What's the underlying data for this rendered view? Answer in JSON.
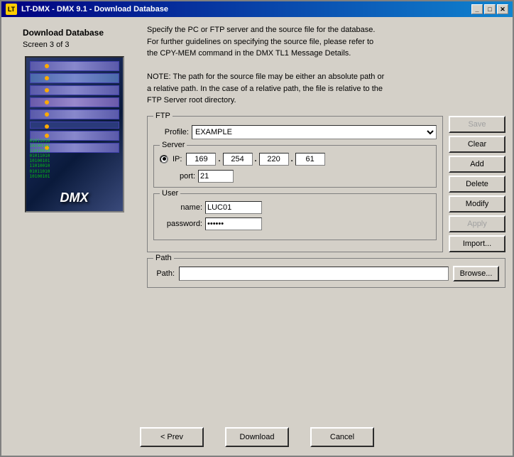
{
  "window": {
    "title": "LT-DMX - DMX 9.1 - Download Database",
    "icon_text": "LT"
  },
  "title_controls": {
    "minimize": "_",
    "maximize": "□",
    "close": "✕"
  },
  "left_panel": {
    "title": "Download Database",
    "subtitle": "Screen 3 of 3",
    "dmx_label": "DMX",
    "binary_lines": [
      "010110100",
      "101001010",
      "110100101",
      "010110100",
      "101001011"
    ]
  },
  "description": {
    "line1": "Specify the PC or FTP server and the source file for the database.",
    "line2": "For further guidelines on specifying the source file, please refer to",
    "line3": "the CPY-MEM command in the DMX TL1 Message Details.",
    "note1": "NOTE: The path for the source file may be either an absolute path or",
    "note2": "a relative path. In the case of a relative path, the file is relative to the",
    "note3": "FTP Server root directory."
  },
  "ftp": {
    "group_label": "FTP",
    "profile_label": "Profile:",
    "profile_value": "EXAMPLE",
    "profile_options": [
      "EXAMPLE"
    ],
    "server": {
      "group_label": "Server",
      "ip_label": "IP:",
      "ip_octet1": "169",
      "ip_octet2": "254",
      "ip_octet3": "220",
      "ip_octet4": "61",
      "port_label": "port:",
      "port_value": "21"
    },
    "user": {
      "group_label": "User",
      "name_label": "name:",
      "name_value": "LUC01",
      "password_label": "password:",
      "password_value": "••••••"
    }
  },
  "buttons": {
    "save": "Save",
    "clear": "Clear",
    "add": "Add",
    "delete": "Delete",
    "modify": "Modify",
    "apply": "Apply",
    "import": "Import..."
  },
  "path": {
    "group_label": "Path",
    "path_label": "Path:",
    "path_value": "",
    "browse_label": "Browse..."
  },
  "bottom_buttons": {
    "prev": "< Prev",
    "download": "Download",
    "cancel": "Cancel"
  }
}
